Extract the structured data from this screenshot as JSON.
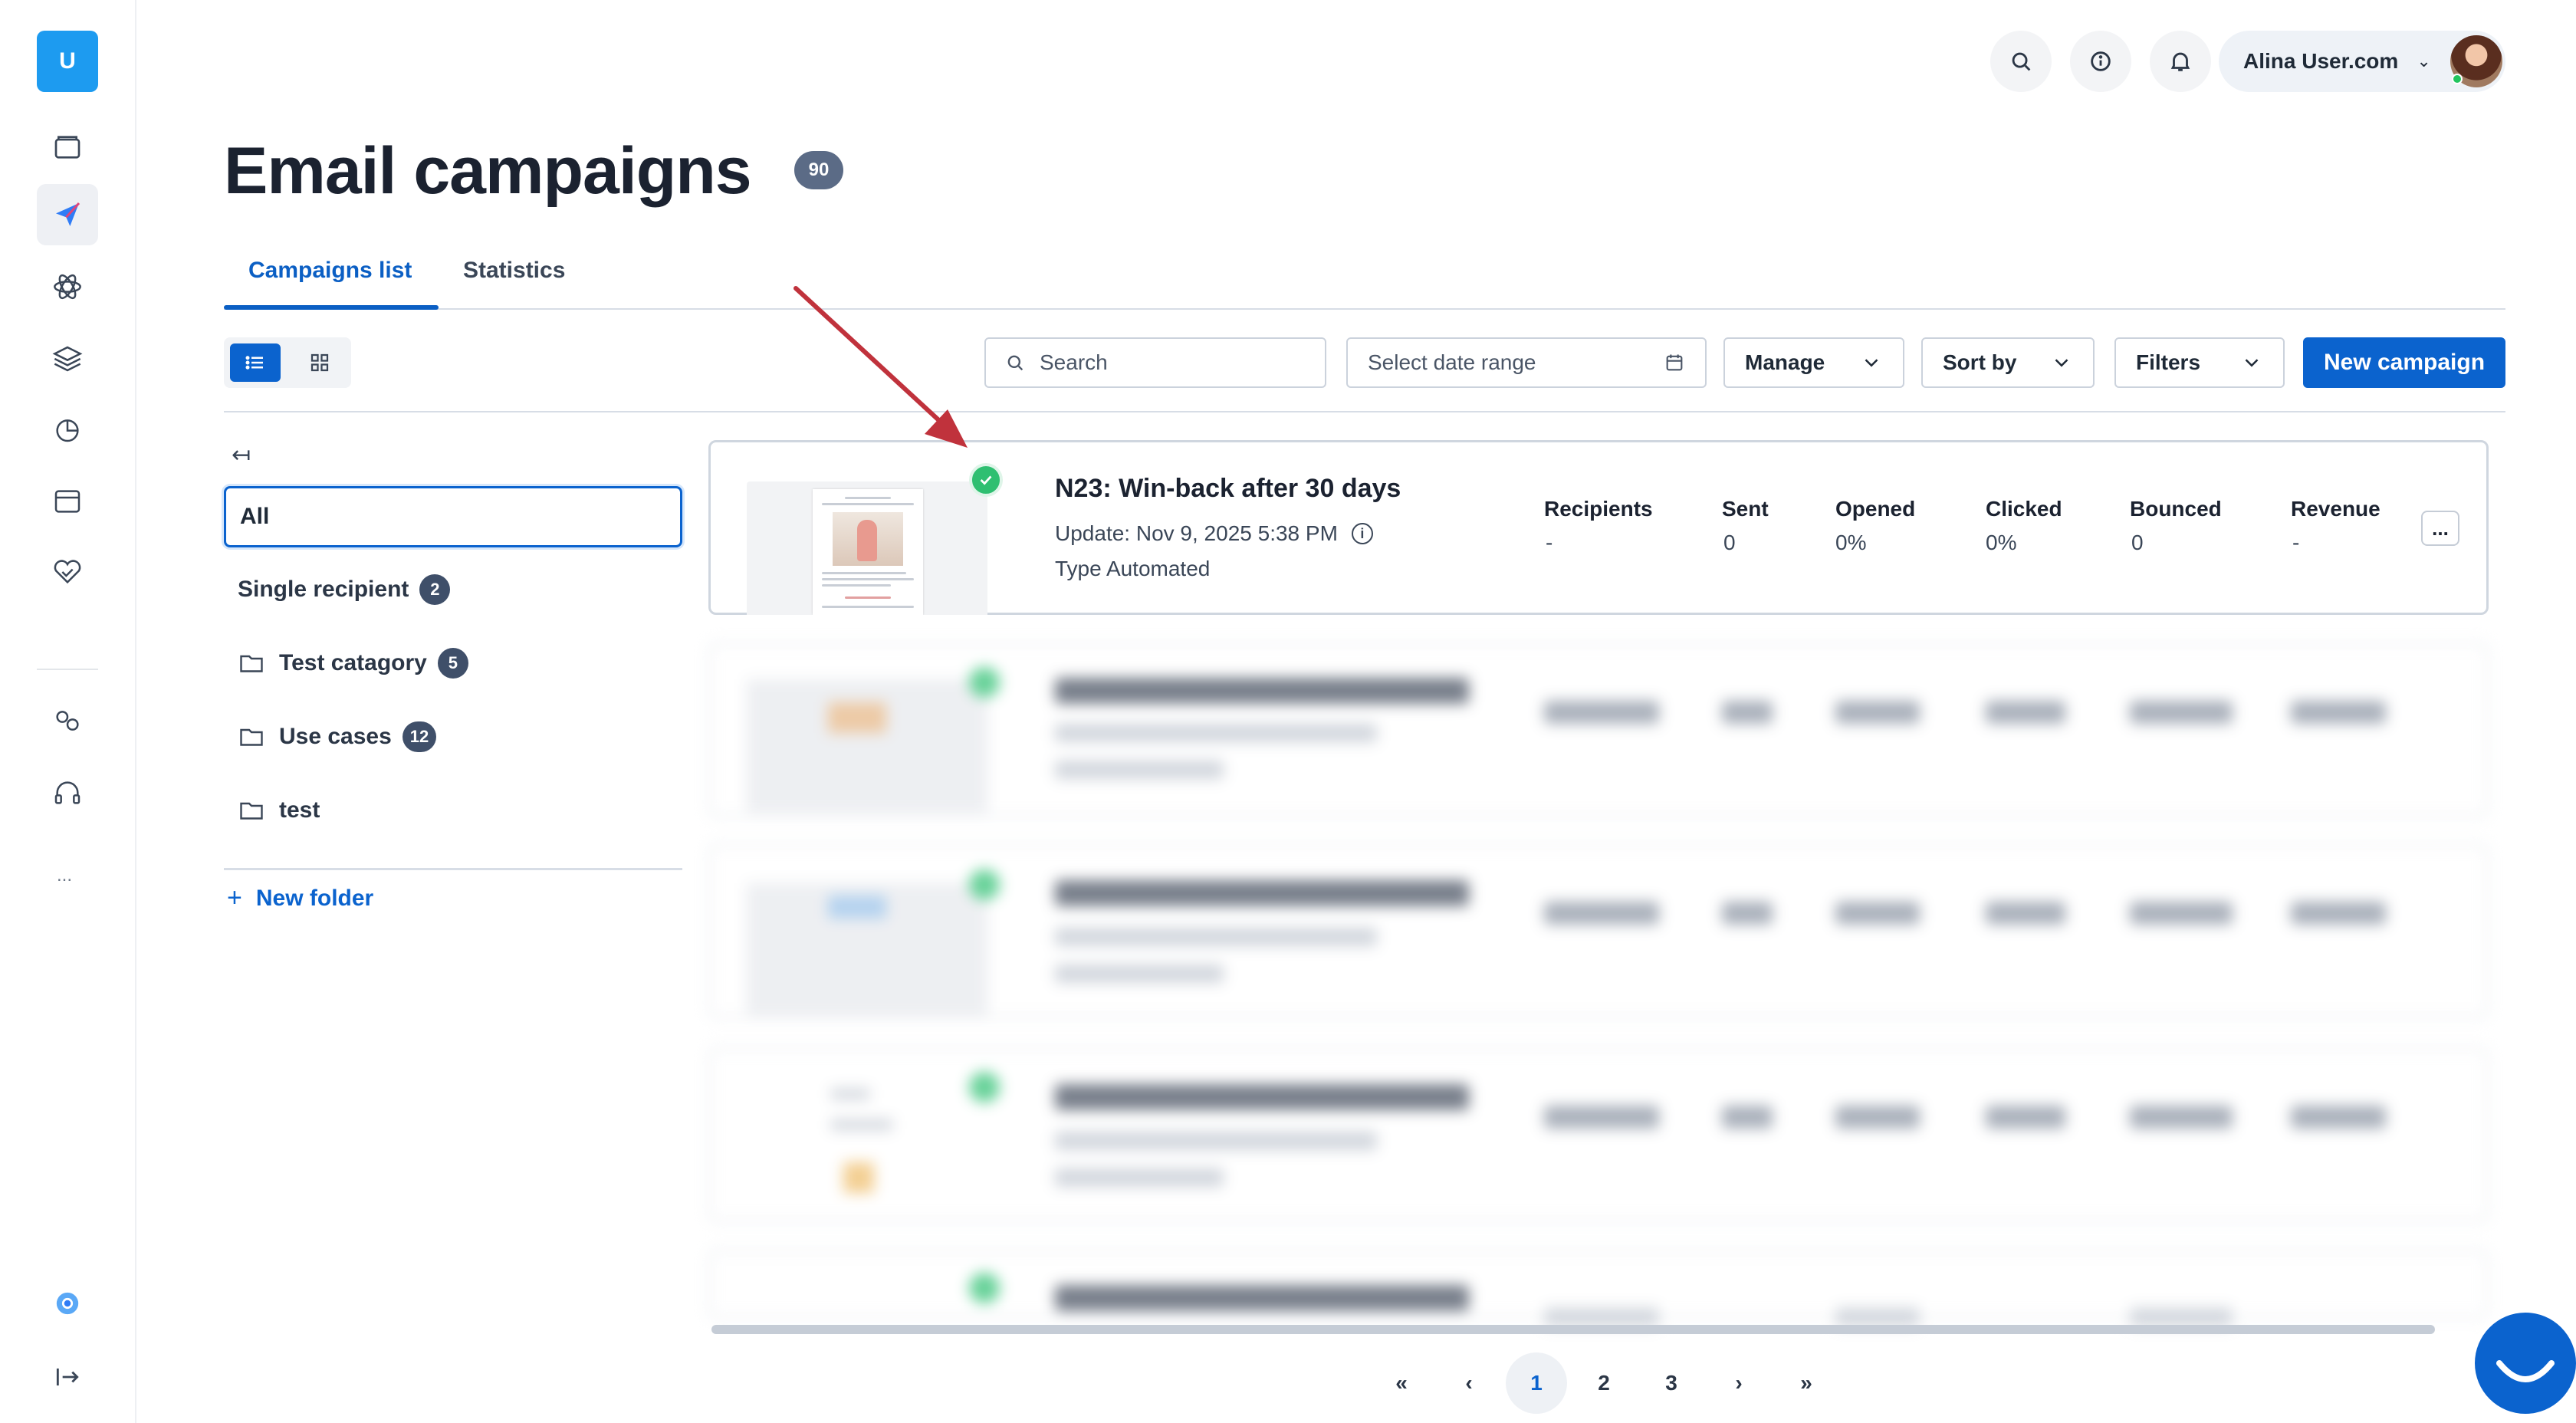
{
  "sidebar": {
    "logo_letter": "U",
    "more_label": "...",
    "items": [
      {
        "icon": "inbox-icon"
      },
      {
        "icon": "send-icon"
      },
      {
        "icon": "atom-icon"
      },
      {
        "icon": "layers-icon"
      },
      {
        "icon": "chart-pie-icon"
      },
      {
        "icon": "window-icon"
      },
      {
        "icon": "handshake-icon"
      },
      {
        "icon": "integrations-icon"
      },
      {
        "icon": "headset-icon"
      }
    ],
    "accent": "#1d9bf0"
  },
  "topbar": {
    "user_name": "Alina User.com",
    "icons": [
      "search-icon",
      "info-icon",
      "bell-icon"
    ]
  },
  "page": {
    "title": "Email campaigns",
    "count": "90"
  },
  "tabs": [
    {
      "label": "Campaigns list",
      "active": true
    },
    {
      "label": "Statistics",
      "active": false
    }
  ],
  "toolbar": {
    "search_placeholder": "Search",
    "date_placeholder": "Select date range",
    "manage_label": "Manage",
    "sort_label": "Sort by",
    "filters_label": "Filters",
    "new_campaign_label": "New campaign",
    "primary_color": "#0b63ce"
  },
  "folders": {
    "all_label": "All",
    "items": [
      {
        "label": "Single recipient",
        "count": "2",
        "folder_icon": false
      },
      {
        "label": "Test catagory",
        "count": "5",
        "folder_icon": true
      },
      {
        "label": "Use cases",
        "count": "12",
        "folder_icon": true
      },
      {
        "label": "test",
        "count": "",
        "folder_icon": true
      }
    ],
    "new_folder_label": "New folder"
  },
  "campaign": {
    "name": "N23: Win-back after 30 days",
    "update": "Update: Nov 9, 2025 5:38 PM",
    "type": "Type Automated",
    "metrics": [
      {
        "label": "Recipients",
        "value": "-"
      },
      {
        "label": "Sent",
        "value": "0"
      },
      {
        "label": "Opened",
        "value": "0%"
      },
      {
        "label": "Clicked",
        "value": "0%"
      },
      {
        "label": "Bounced",
        "value": "0"
      },
      {
        "label": "Revenue",
        "value": "-"
      }
    ],
    "more_label": "...",
    "status_color": "#2fbf71"
  },
  "pagination": {
    "first": "«",
    "prev": "‹",
    "pages": [
      "1",
      "2",
      "3"
    ],
    "current": "1",
    "next": "›",
    "last": "»"
  },
  "annotation_color": "#c0323c"
}
